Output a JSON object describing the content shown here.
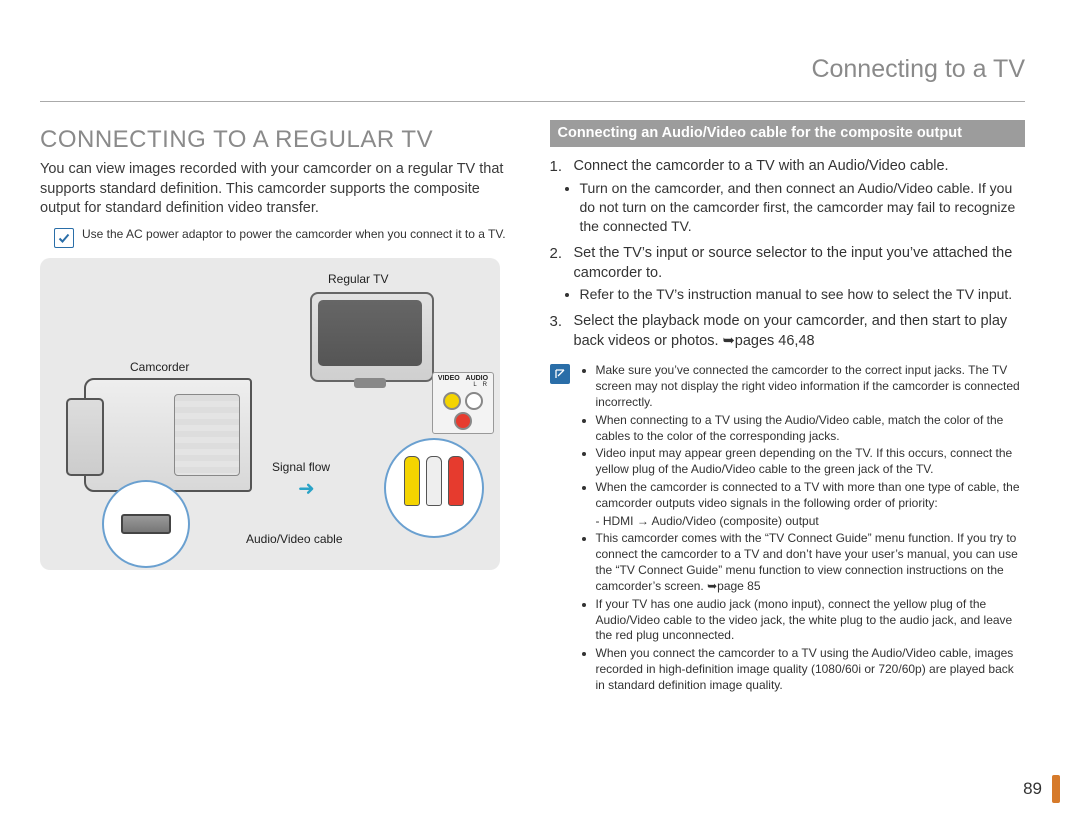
{
  "header": {
    "section_title": "Connecting to a TV"
  },
  "left": {
    "heading": "CONNECTING TO A REGULAR TV",
    "intro": "You can view images recorded with your camcorder on a regular TV that supports standard definition. This camcorder supports the composite output for standard definition video transfer.",
    "note": "Use the AC power adaptor to power the camcorder when you connect it to a TV.",
    "diagram": {
      "regular_tv": "Regular TV",
      "camcorder": "Camcorder",
      "signal_flow": "Signal flow",
      "av_cable": "Audio/Video cable",
      "video": "VIDEO",
      "audio": "AUDIO",
      "l": "L",
      "r": "R"
    }
  },
  "right": {
    "subhead": "Connecting an Audio/Video cable for the composite output",
    "steps": [
      {
        "num": "1.",
        "text": "Connect the camcorder to a TV with an Audio/Video cable.",
        "bullets": [
          "Turn on the camcorder, and then connect an Audio/Video cable. If you do not turn on the camcorder first, the camcorder may fail to recognize the connected TV."
        ]
      },
      {
        "num": "2.",
        "text": "Set the TV’s input or source selector to the input you’ve attached the camcorder to.",
        "bullets": [
          "Refer to the TV’s instruction manual to see how to select the TV input."
        ]
      },
      {
        "num": "3.",
        "text": "Select the playback mode on your camcorder, and then start to play back videos or photos. ➥pages 46,48",
        "bullets": []
      }
    ],
    "tips": [
      "Make sure you’ve connected the camcorder to the correct input jacks. The TV screen may not display the right video information if the camcorder is connected incorrectly.",
      "When connecting to a TV using the Audio/Video cable, match the color of the cables to the color of the corresponding jacks.",
      "Video input may appear green depending on the TV. If this occurs, connect the yellow plug of the Audio/Video cable to the green jack of the TV.",
      "When the camcorder is connected to a TV with more than one type of cable, the camcorder outputs video signals in the following order of priority:",
      "HDMI → Audio/Video (composite) output",
      "This camcorder comes with the “TV Connect Guide” menu function. If you try to connect the camcorder to a TV and don’t have your user’s manual, you can use the “TV Connect Guide” menu function to view connection instructions on the camcorder’s screen. ➥page 85",
      "If your TV has one audio jack (mono input), connect the yellow plug of the Audio/Video cable to the video jack, the white plug to the audio jack, and leave the red plug unconnected.",
      "When you connect the camcorder to a TV using the Audio/Video cable, images recorded in high-definition image quality (1080/60i or 720/60p) are played back in standard definition image quality."
    ]
  },
  "page_number": "89"
}
